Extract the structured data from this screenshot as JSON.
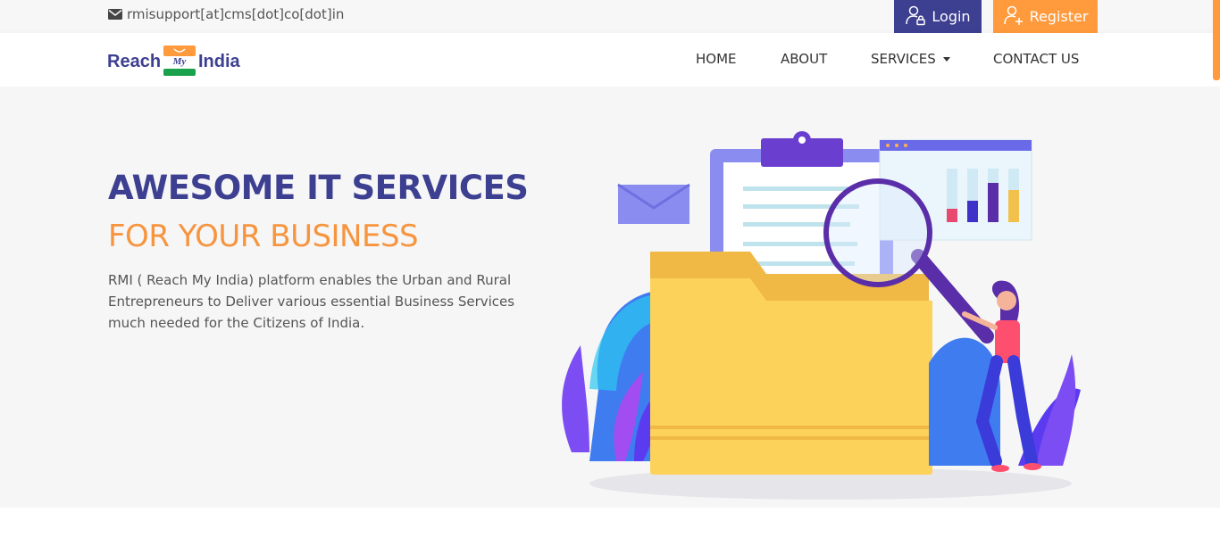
{
  "topbar": {
    "email": "rmisupport[at]cms[dot]co[dot]in",
    "login_label": "Login",
    "register_label": "Register"
  },
  "logo": {
    "reach": "Reach",
    "my": "My",
    "india": "India"
  },
  "nav": {
    "items": [
      {
        "label": "HOME"
      },
      {
        "label": "ABOUT"
      },
      {
        "label": "SERVICES"
      },
      {
        "label": "CONTACT US"
      }
    ]
  },
  "hero": {
    "title": "AWESOME IT SERVICES",
    "subtitle": "FOR YOUR BUSINESS",
    "description": "RMI ( Reach My India) platform enables the Urban and Rural Entrepreneurs to Deliver various essential Business Services much needed for the Citizens of India."
  },
  "colors": {
    "brand_blue": "#3d3f91",
    "brand_orange": "#ff9a3d",
    "hero_bg": "#f6f6f7"
  },
  "icons": {
    "email": "envelope-icon",
    "login": "user-lock-icon",
    "register": "user-plus-icon",
    "services_dropdown": "caret-down-icon"
  }
}
